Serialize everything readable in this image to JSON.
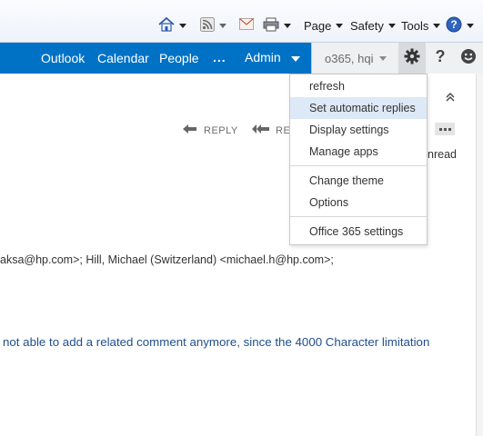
{
  "ie_toolbar": {
    "home_icon": "home-icon",
    "feeds_icon": "rss-feed-icon",
    "mail_icon": "read-mail-icon",
    "print_icon": "printer-icon",
    "page_label": "Page",
    "safety_label": "Safety",
    "tools_label": "Tools",
    "help_icon": "help-icon"
  },
  "nav": {
    "outlook": "Outlook",
    "calendar": "Calendar",
    "people": "People",
    "more": "...",
    "admin": "Admin",
    "user": "o365, hqi",
    "accent": "#0072c6"
  },
  "settings_menu": {
    "items": [
      "refresh",
      "Set automatic replies",
      "Display settings",
      "Manage apps",
      "Change theme",
      "Options",
      "Office 365 settings"
    ],
    "highlighted": "Set automatic replies"
  },
  "message": {
    "reply_label": "REPLY",
    "reply_all_label_visible": "RE",
    "unread_visible": "nread",
    "recipients": "aksa@hp.com>;  Hill, Michael (Switzerland) <michael.h@hp.com>;",
    "body": "not able to add a related comment anymore, since the 4000 Character limitation"
  }
}
